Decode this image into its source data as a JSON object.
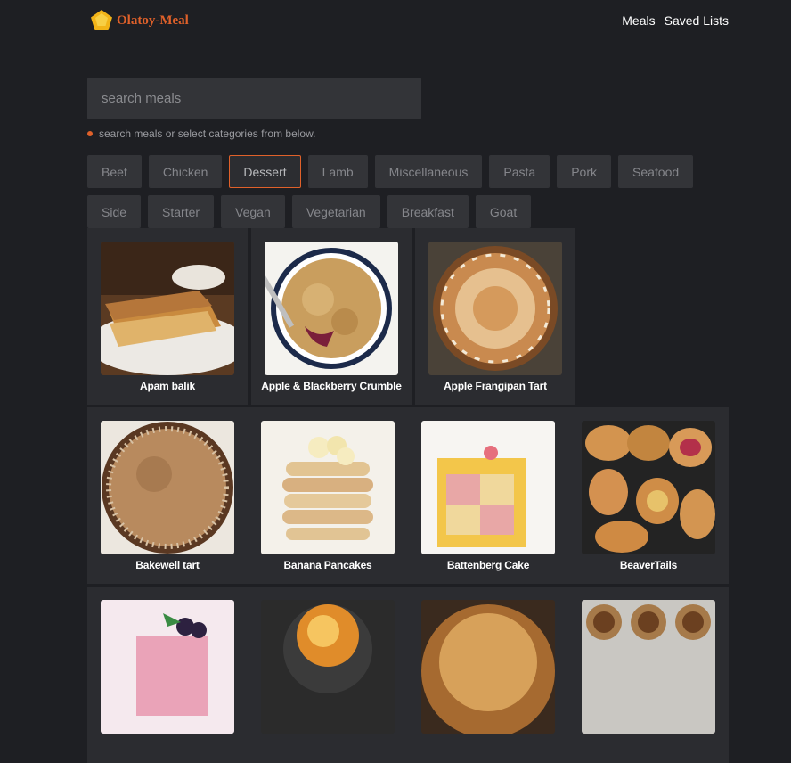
{
  "header": {
    "logo_text": "Olatoy-Meal",
    "nav": [
      "Meals",
      "Saved Lists"
    ]
  },
  "search": {
    "placeholder": "search meals",
    "value": ""
  },
  "hint": "search meals or select categories from below.",
  "categories": [
    "Beef",
    "Chicken",
    "Dessert",
    "Lamb",
    "Miscellaneous",
    "Pasta",
    "Pork",
    "Seafood",
    "Side",
    "Starter",
    "Vegan",
    "Vegetarian",
    "Breakfast",
    "Goat"
  ],
  "active_category": "Dessert",
  "meals": [
    {
      "name": "Apam balik"
    },
    {
      "name": "Apple & Blackberry Crumble"
    },
    {
      "name": "Apple Frangipan Tart"
    },
    {
      "name": "Bakewell tart"
    },
    {
      "name": "Banana Pancakes"
    },
    {
      "name": "Battenberg Cake"
    },
    {
      "name": "BeaverTails"
    },
    {
      "name": ""
    },
    {
      "name": ""
    },
    {
      "name": ""
    },
    {
      "name": ""
    }
  ],
  "colors": {
    "accent": "#e0612a",
    "background": "#1e1f23",
    "card": "#2b2c30",
    "input": "#333438"
  }
}
